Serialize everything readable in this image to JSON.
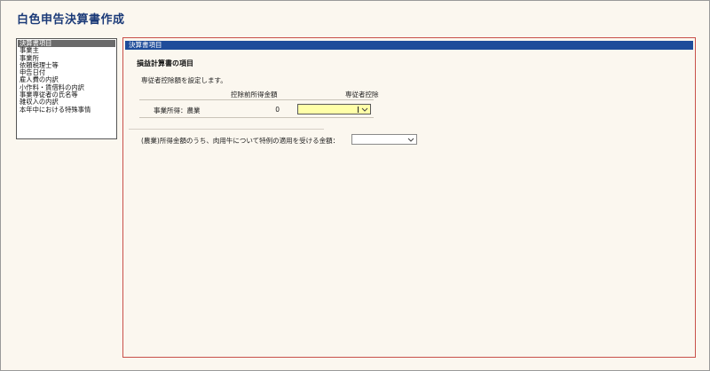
{
  "page": {
    "title": "白色申告決算書作成"
  },
  "sidebar": {
    "items": [
      {
        "label": "決算書項目",
        "selected": true
      },
      {
        "label": "事業主",
        "selected": false
      },
      {
        "label": "事業所",
        "selected": false
      },
      {
        "label": "依頼税理士等",
        "selected": false
      },
      {
        "label": "申告日付",
        "selected": false
      },
      {
        "label": "雇人費の内訳",
        "selected": false
      },
      {
        "label": "小作料・賃借料の内訳",
        "selected": false
      },
      {
        "label": "事業専従者の氏名等",
        "selected": false
      },
      {
        "label": "雑収入の内訳",
        "selected": false
      },
      {
        "label": "本年中における特殊事情",
        "selected": false
      }
    ]
  },
  "panel": {
    "header": "決算書項目",
    "section_title": "損益計算書の項目",
    "instruction": "専従者控除額を設定します。",
    "columns": {
      "pre_deduction_income": "控除前所得金額",
      "employee_deduction": "専従者控除"
    },
    "row": {
      "label": "事業所得：農業",
      "pre_deduction_income": "0",
      "employee_deduction_value": ""
    },
    "question": {
      "label": "(農業)所得金額のうち、肉用牛について特例の適用を受ける金額：",
      "value": ""
    }
  },
  "colors": {
    "header_bg": "#1f4c9a",
    "panel_border": "#c8504a",
    "title_color": "#1b3a78",
    "highlight": "#ffffa8"
  }
}
